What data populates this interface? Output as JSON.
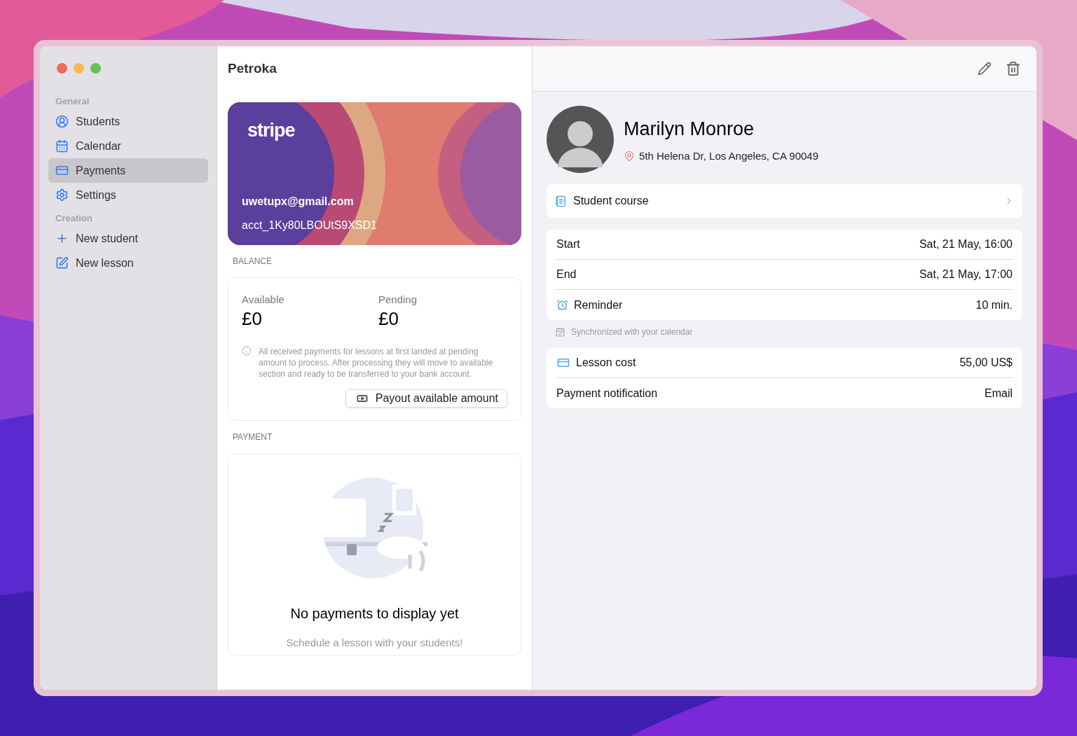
{
  "sidebar": {
    "sections": [
      {
        "title": "General",
        "items": [
          {
            "label": "Students",
            "selected": false
          },
          {
            "label": "Calendar",
            "selected": false
          },
          {
            "label": "Payments",
            "selected": true
          },
          {
            "label": "Settings",
            "selected": false
          }
        ]
      },
      {
        "title": "Creation",
        "items": [
          {
            "label": "New student",
            "selected": false
          },
          {
            "label": "New lesson",
            "selected": false
          }
        ]
      }
    ]
  },
  "middle": {
    "title": "Petroka",
    "stripe_card": {
      "logo": "stripe",
      "email": "uwetupx@gmail.com",
      "account": "acct_1Ky80LBOUtS9XSD1"
    },
    "balance": {
      "heading": "BALANCE",
      "available_label": "Available",
      "available": "£0",
      "pending_label": "Pending",
      "pending": "£0",
      "note": "All received payments for lessons at first landed at pending amount to process. After processing they will move to available section and ready to be transferred to your bank account.",
      "button": "Payout available amount"
    },
    "payment": {
      "heading": "PAYMENT",
      "empty_title": "No payments to display yet",
      "empty_subtitle": "Schedule a lesson with your students!"
    }
  },
  "detail": {
    "name": "Marilyn Monroe",
    "address": "5th Helena Dr, Los Angeles, CA 90049",
    "course": "Student course",
    "schedule": [
      {
        "kind": "plain",
        "label": "Start",
        "value": "Sat, 21 May, 16:00"
      },
      {
        "kind": "plain",
        "label": "End",
        "value": "Sat, 21 May, 17:00"
      },
      {
        "kind": "reminder",
        "label": "Reminder",
        "value": "10 min."
      }
    ],
    "sync_note": "Synchronized with your calendar",
    "billing": [
      {
        "kind": "cost",
        "label": "Lesson cost",
        "value": "55,00 US$"
      },
      {
        "kind": "plain",
        "label": "Payment notification",
        "value": "Email"
      }
    ]
  }
}
